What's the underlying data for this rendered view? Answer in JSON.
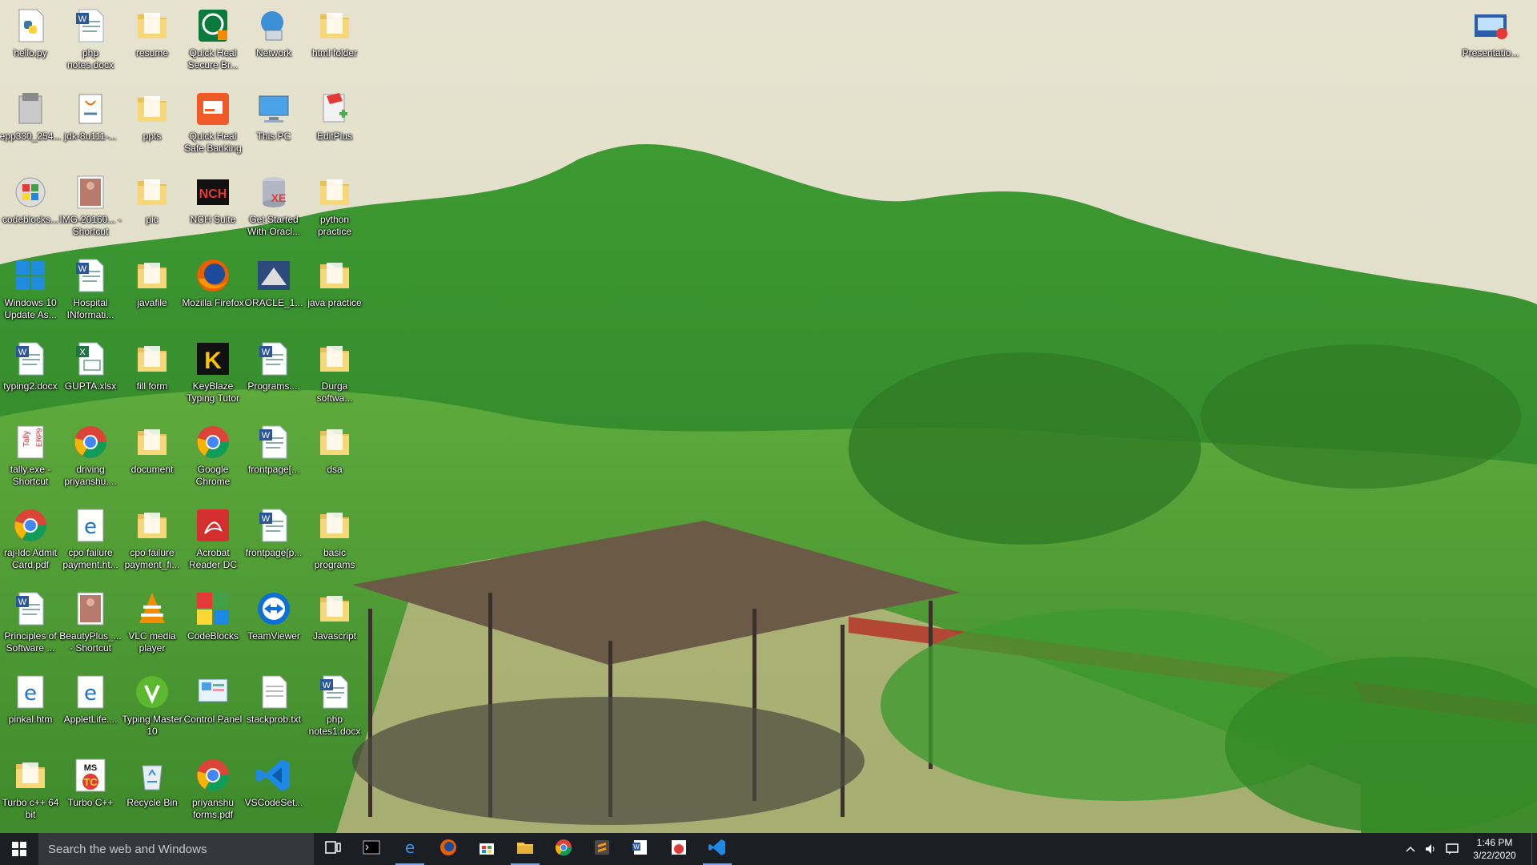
{
  "desktop": {
    "icons": [
      {
        "label": "hello.py",
        "icon": "python-file-icon"
      },
      {
        "label": "php notes.docx",
        "icon": "word-doc-icon"
      },
      {
        "label": "resume",
        "icon": "folder-icon"
      },
      {
        "label": "Quick Heal Secure Br...",
        "icon": "quick-heal-browser-icon"
      },
      {
        "label": "Network",
        "icon": "network-icon"
      },
      {
        "label": "html folder",
        "icon": "folder-icon"
      },
      {
        "label": "epp330_254...",
        "icon": "installer-icon"
      },
      {
        "label": "jdk-8u111-...",
        "icon": "java-installer-icon"
      },
      {
        "label": "ppts",
        "icon": "folder-icon"
      },
      {
        "label": "Quick Heal Safe Banking",
        "icon": "quick-heal-banking-icon"
      },
      {
        "label": "This PC",
        "icon": "this-pc-icon"
      },
      {
        "label": "EditPlus",
        "icon": "editplus-icon"
      },
      {
        "label": "codeblocks...",
        "icon": "codeblocks-setup-icon"
      },
      {
        "label": "IMG-20160... - Shortcut",
        "icon": "image-file-icon"
      },
      {
        "label": "pic",
        "icon": "folder-icon"
      },
      {
        "label": "NCH Suite",
        "icon": "nch-suite-icon"
      },
      {
        "label": "Get Started With Oracl...",
        "icon": "oracle-xe-icon"
      },
      {
        "label": "python practice",
        "icon": "folder-icon"
      },
      {
        "label": "Windows 10 Update As...",
        "icon": "windows-logo-icon"
      },
      {
        "label": "Hospital INformati...",
        "icon": "word-doc-icon"
      },
      {
        "label": "javafile",
        "icon": "folder-icon"
      },
      {
        "label": "Mozilla Firefox",
        "icon": "firefox-icon"
      },
      {
        "label": "ORACLE_1...",
        "icon": "oracle-installer-icon"
      },
      {
        "label": "java practice",
        "icon": "folder-icon"
      },
      {
        "label": "typing2.docx",
        "icon": "word-doc-icon"
      },
      {
        "label": "GUPTA.xlsx",
        "icon": "excel-file-icon"
      },
      {
        "label": "fill form",
        "icon": "folder-icon"
      },
      {
        "label": "KeyBlaze Typing Tutor",
        "icon": "keyblaze-icon"
      },
      {
        "label": "Programs....",
        "icon": "word-doc-icon"
      },
      {
        "label": "Durga softwa...",
        "icon": "folder-icon"
      },
      {
        "label": "tally.exe - Shortcut",
        "icon": "tally-icon"
      },
      {
        "label": "driving priyanshu....",
        "icon": "chrome-icon"
      },
      {
        "label": "document",
        "icon": "folder-icon"
      },
      {
        "label": "Google Chrome",
        "icon": "chrome-icon"
      },
      {
        "label": "frontpage[...",
        "icon": "word-doc-icon"
      },
      {
        "label": "dsa",
        "icon": "folder-icon"
      },
      {
        "label": "raj-ldc Admit Card.pdf",
        "icon": "chrome-icon"
      },
      {
        "label": "cpo failure payment.ht...",
        "icon": "edge-icon"
      },
      {
        "label": "cpo failure payment_fi...",
        "icon": "folder-icon"
      },
      {
        "label": "Acrobat Reader DC",
        "icon": "acrobat-icon"
      },
      {
        "label": "frontpage[p...",
        "icon": "word-doc-icon"
      },
      {
        "label": "basic programs",
        "icon": "folder-icon"
      },
      {
        "label": "Principles of Software ...",
        "icon": "word-doc-icon"
      },
      {
        "label": "BeautyPlus_... - Shortcut",
        "icon": "image-file-icon"
      },
      {
        "label": "VLC media player",
        "icon": "vlc-icon"
      },
      {
        "label": "CodeBlocks",
        "icon": "codeblocks-icon"
      },
      {
        "label": "TeamViewer",
        "icon": "teamviewer-icon"
      },
      {
        "label": "Javascript",
        "icon": "folder-icon"
      },
      {
        "label": "pinkal.htm",
        "icon": "edge-icon"
      },
      {
        "label": "AppletLife....",
        "icon": "edge-icon"
      },
      {
        "label": "Typing Master 10",
        "icon": "typing-master-icon"
      },
      {
        "label": "Control Panel",
        "icon": "control-panel-icon"
      },
      {
        "label": "stackprob.txt",
        "icon": "text-file-icon"
      },
      {
        "label": "php notes1.docx",
        "icon": "word-doc-icon"
      },
      {
        "label": "Turbo c++ 64 bit",
        "icon": "folder-icon"
      },
      {
        "label": "Turbo C++",
        "icon": "turbo-cpp-icon"
      },
      {
        "label": "Recycle Bin",
        "icon": "recycle-bin-icon"
      },
      {
        "label": "priyanshu forms.pdf",
        "icon": "chrome-icon"
      },
      {
        "label": "VSCodeSet...",
        "icon": "vscode-icon"
      },
      {
        "label": "Presentatio...",
        "icon": "presentation-icon"
      }
    ]
  },
  "taskbar": {
    "search_placeholder": "Search the web and Windows",
    "apps": [
      {
        "icon": "task-view-icon",
        "active": false
      },
      {
        "icon": "command-prompt-icon",
        "active": false
      },
      {
        "icon": "edge-icon",
        "active": true
      },
      {
        "icon": "firefox-icon",
        "active": false
      },
      {
        "icon": "store-icon",
        "active": false
      },
      {
        "icon": "file-explorer-icon",
        "active": true
      },
      {
        "icon": "chrome-icon",
        "active": false
      },
      {
        "icon": "sublime-icon",
        "active": false
      },
      {
        "icon": "word-icon",
        "active": false
      },
      {
        "icon": "turbo-cpp-icon",
        "active": false
      },
      {
        "icon": "vscode-icon",
        "active": true
      }
    ],
    "clock_time": "1:46 PM",
    "clock_date": "3/22/2020"
  },
  "colors": {
    "taskbar_bg": "#1b1f24",
    "accent": "#7aa7e0"
  }
}
